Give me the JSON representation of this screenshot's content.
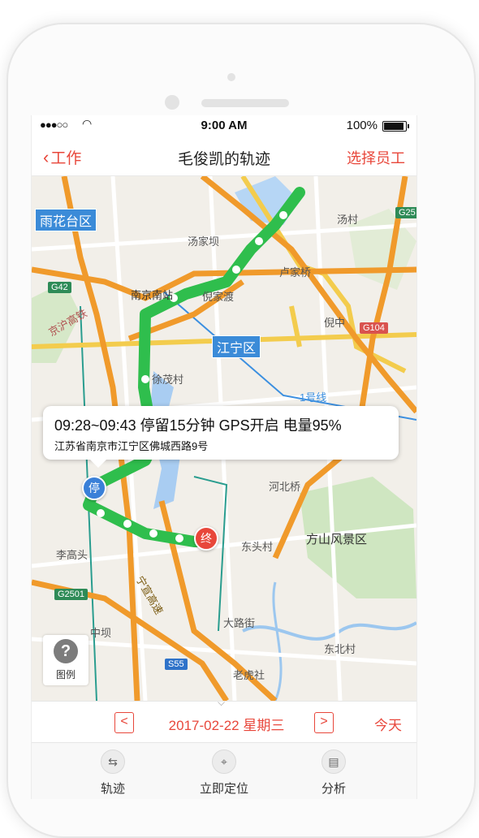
{
  "status_bar": {
    "signal": "●●●○○",
    "time": "9:00 AM",
    "battery": "100%"
  },
  "nav": {
    "back_label": "工作",
    "title": "毛俊凯的轨迹",
    "right_action": "选择员工"
  },
  "map": {
    "districts": [
      "雨花台区",
      "江宁区"
    ],
    "places": [
      "汤家坝",
      "汤村",
      "卢家桥",
      "南京南站",
      "倪家渡",
      "倪中",
      "徐茂村",
      "1号线",
      "河北桥",
      "方山风景区",
      "李高头",
      "东头村",
      "中坝",
      "大路街",
      "东北村",
      "老虎社",
      "京沪高铁",
      "宁宣高速"
    ],
    "road_signs": [
      "G42",
      "G25",
      "G104",
      "G2501",
      "S55"
    ],
    "callout": {
      "line1": "09:28~09:43 停留15分钟 GPS开启 电量95%",
      "line2": "江苏省南京市江宁区佛城西路9号"
    },
    "stop_marker": "停",
    "end_marker": "终",
    "legend_label": "图例",
    "route_color": "#2fbe4d"
  },
  "date_bar": {
    "prev": "<",
    "date": "2017-02-22 星期三",
    "next": ">",
    "today": "今天"
  },
  "tabs": [
    {
      "label": "轨迹",
      "icon": "route-icon"
    },
    {
      "label": "立即定位",
      "icon": "locate-icon"
    },
    {
      "label": "分析",
      "icon": "analysis-icon"
    }
  ]
}
